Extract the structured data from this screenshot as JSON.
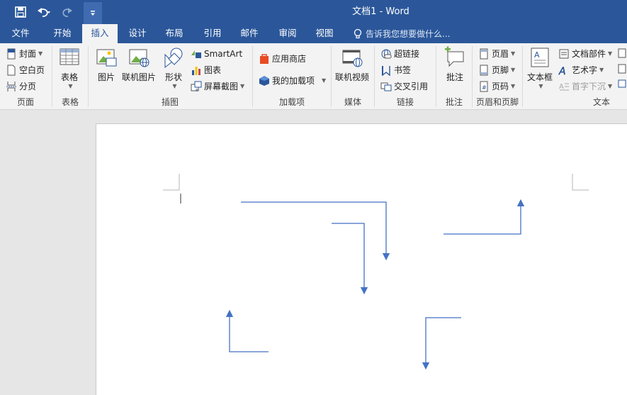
{
  "window": {
    "title": "文档1 - Word"
  },
  "qat": {
    "save_icon": "save-icon",
    "undo_icon": "undo-icon",
    "redo_icon": "redo-icon",
    "customize_icon": "customize-qat-icon"
  },
  "tabs": [
    {
      "label": "文件"
    },
    {
      "label": "开始"
    },
    {
      "label": "插入"
    },
    {
      "label": "设计"
    },
    {
      "label": "布局"
    },
    {
      "label": "引用"
    },
    {
      "label": "邮件"
    },
    {
      "label": "审阅"
    },
    {
      "label": "视图"
    }
  ],
  "active_tab": "插入",
  "tell_me": {
    "placeholder": "告诉我您想要做什么..."
  },
  "ribbon": {
    "pages": {
      "label": "页面",
      "cover": "封面",
      "blank": "空白页",
      "break": "分页"
    },
    "tables": {
      "label": "表格",
      "table": "表格"
    },
    "illustrations": {
      "label": "插图",
      "picture": "图片",
      "online_picture": "联机图片",
      "shapes": "形状",
      "smartart": "SmartArt",
      "chart": "图表",
      "screenshot": "屏幕截图"
    },
    "addins": {
      "label": "加载项",
      "store": "应用商店",
      "my_addins": "我的加载项"
    },
    "media": {
      "label": "媒体",
      "online_video": "联机视频"
    },
    "links": {
      "label": "链接",
      "hyperlink": "超链接",
      "bookmark": "书签",
      "cross_ref": "交叉引用"
    },
    "comments": {
      "label": "批注",
      "comment": "批注"
    },
    "header_footer": {
      "label": "页眉和页脚",
      "header": "页眉",
      "footer": "页脚",
      "page_number": "页码"
    },
    "text": {
      "label": "文本",
      "textbox": "文本框",
      "quick_parts": "文档部件",
      "wordart": "艺术字",
      "dropcap": "首字下沉"
    }
  },
  "colors": {
    "accent": "#2b579a",
    "connector": "#4472c4"
  }
}
